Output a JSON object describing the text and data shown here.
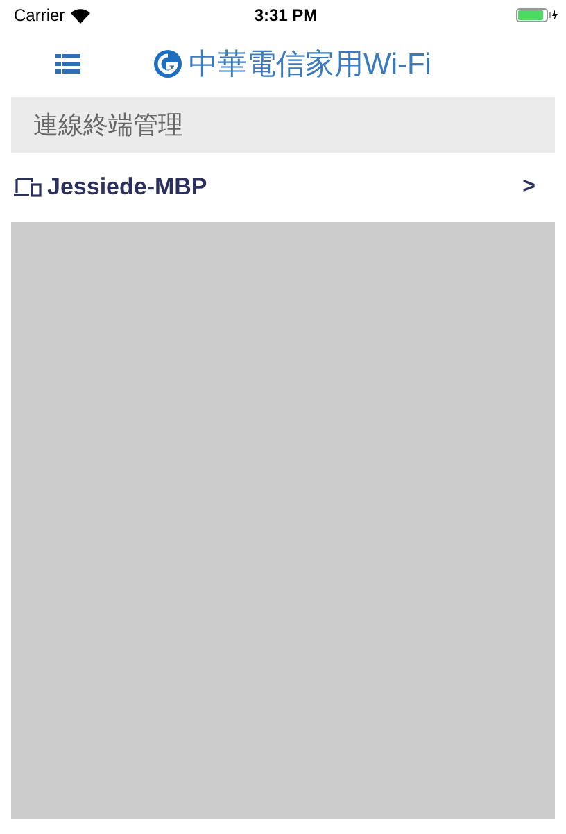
{
  "status_bar": {
    "carrier": "Carrier",
    "time": "3:31 PM"
  },
  "nav": {
    "title": "中華電信家用Wi-Fi"
  },
  "section": {
    "title": "連線終端管理"
  },
  "devices": [
    {
      "name": "Jessiede-MBP",
      "chevron": ">"
    }
  ]
}
